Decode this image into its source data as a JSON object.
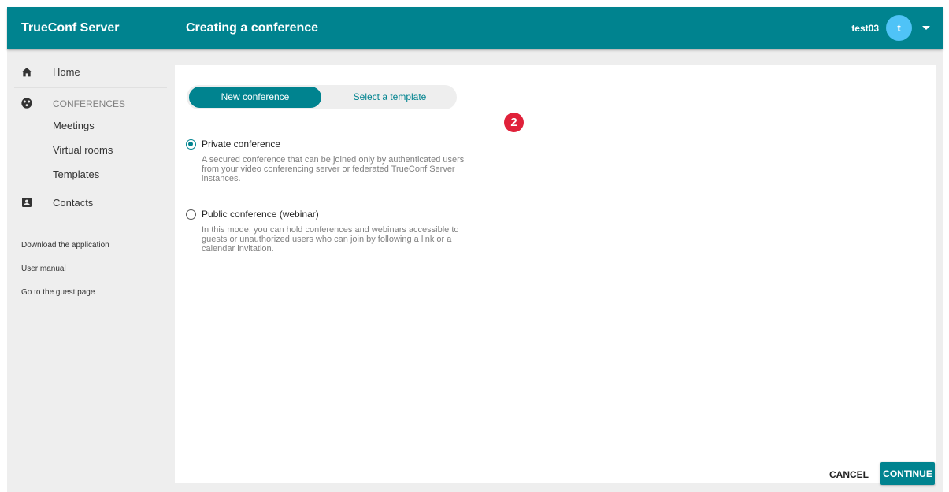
{
  "header": {
    "brand": "TrueConf Server",
    "title": "Creating a conference",
    "username": "test03",
    "avatar_letter": "t"
  },
  "sidebar": {
    "home": "Home",
    "conferences_section": "CONFERENCES",
    "meetings": "Meetings",
    "virtual_rooms": "Virtual rooms",
    "templates": "Templates",
    "contacts": "Contacts",
    "links": [
      "Download the application",
      "User manual",
      "Go to the guest page"
    ]
  },
  "tabs": {
    "new_conference": "New conference",
    "select_template": "Select a template"
  },
  "step_badge": "2",
  "options": [
    {
      "title": "Private conference",
      "description": "A secured conference that can be joined only by authenticated users from your video conferencing server or federated TrueConf Server instances.",
      "checked": true
    },
    {
      "title": "Public conference (webinar)",
      "description": "In this mode, you can hold conferences and webinars accessible to guests or unauthorized users who can join by following a link or a calendar invitation.",
      "checked": false
    }
  ],
  "footer": {
    "cancel": "CANCEL",
    "continue": "CONTINUE"
  },
  "colors": {
    "primary": "#00838f",
    "avatar": "#4fc3f7",
    "highlight": "#e0213a",
    "background": "#eeeeee"
  }
}
